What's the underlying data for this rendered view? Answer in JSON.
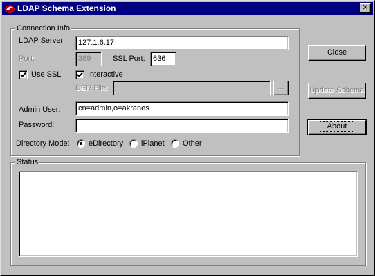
{
  "window": {
    "title": "LDAP Schema Extension",
    "close_glyph": "✕"
  },
  "connection": {
    "group_label": "Connection Info",
    "server_label": "LDAP Server:",
    "server_value": "127.1.6.17",
    "port_label": "Port:",
    "port_value": "389",
    "ssl_port_label": "SSL Port:",
    "ssl_port_value": "636",
    "use_ssl_label": "Use SSL",
    "use_ssl_checked": true,
    "interactive_label": "Interactive",
    "interactive_checked": true,
    "der_file_label": "DER File:",
    "der_file_value": "",
    "browse_label": "...",
    "admin_user_label": "Admin User:",
    "admin_user_value": "cn=admin,o=akranes",
    "password_label": "Password:",
    "password_value": "",
    "directory_mode_label": "Directory Mode:",
    "modes": [
      {
        "label": "eDirectory",
        "selected": true
      },
      {
        "label": "iPlanet",
        "selected": false
      },
      {
        "label": "Other",
        "selected": false
      }
    ]
  },
  "buttons": {
    "close": "Close",
    "update_schema": "Update Schema",
    "about": "About"
  },
  "status": {
    "group_label": "Status",
    "text": ""
  },
  "icons": {
    "app": "red-ribbon-icon",
    "check": "checkmark-icon"
  }
}
